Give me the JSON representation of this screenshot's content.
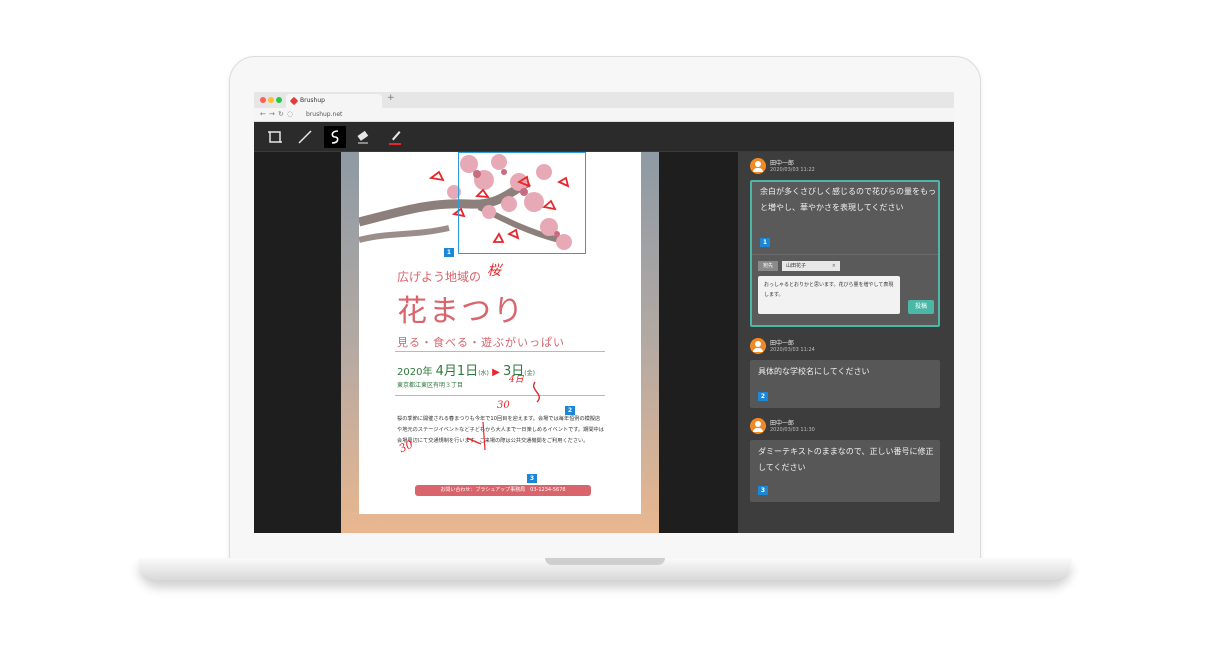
{
  "browser": {
    "tab_title": "Brushup",
    "new_tab": "+",
    "url": "brushup.net"
  },
  "toolbar": {
    "tools": [
      {
        "icon": "crop-square-icon"
      },
      {
        "icon": "line-icon"
      },
      {
        "icon": "freehand-icon",
        "active": true
      },
      {
        "icon": "eraser-icon"
      },
      {
        "icon": "pen-color-icon",
        "color": "#e8262b"
      }
    ]
  },
  "poster": {
    "subtitle": "広げよう地域の",
    "title": "花まつり",
    "tagline": "見る・食べる・遊ぶがいっぱい",
    "date_year": "2020年",
    "date_start": "4月1日",
    "date_start_day": "(水)",
    "date_end": "3日",
    "date_end_day": "(金)",
    "place": "東京都江東区有明３丁目",
    "body": "桜の季節に開催される春まつりも今年で10回目を迎えます。会場では毎年恒例の模擬店や地元のステージイベントなど子どもから大人まで一日楽しめるイベントです。期間中は会場周辺にて交通規制を行います。ご来場の際は公共交通機関をご利用ください。",
    "contact": "お問い合わせ：ブラシュアップ事務局　03-1234-5678",
    "markers": [
      "1",
      "2",
      "3"
    ],
    "handwriting": [
      "桜",
      "4日",
      "30",
      "30"
    ]
  },
  "comments": [
    {
      "author": "田中一郎",
      "time": "2020/03/03 11:22",
      "text": "余白が多くさびしく感じるので花びらの量をもっと増やし、華やかさを表現してください",
      "number": "1",
      "active": true,
      "reply": {
        "label": "宛先",
        "recipient": "山田花子",
        "remove": "×",
        "draft": "おっしゃるとおりかと思います。花びら量を増やして表現します。",
        "post_label": "投稿"
      }
    },
    {
      "author": "田中一郎",
      "time": "2020/03/03 11:24",
      "text": "具体的な学校名にしてください",
      "number": "2"
    },
    {
      "author": "田中一郎",
      "time": "2020/03/03 11:30",
      "text": "ダミーテキストのままなので、正しい番号に修正してください",
      "number": "3"
    }
  ],
  "colors": {
    "accent": "#4bb7a7",
    "marker": "#1d87d6",
    "poster_red": "#d9646b",
    "annotation_red": "#e8262b",
    "avatar": "#f08a24"
  }
}
